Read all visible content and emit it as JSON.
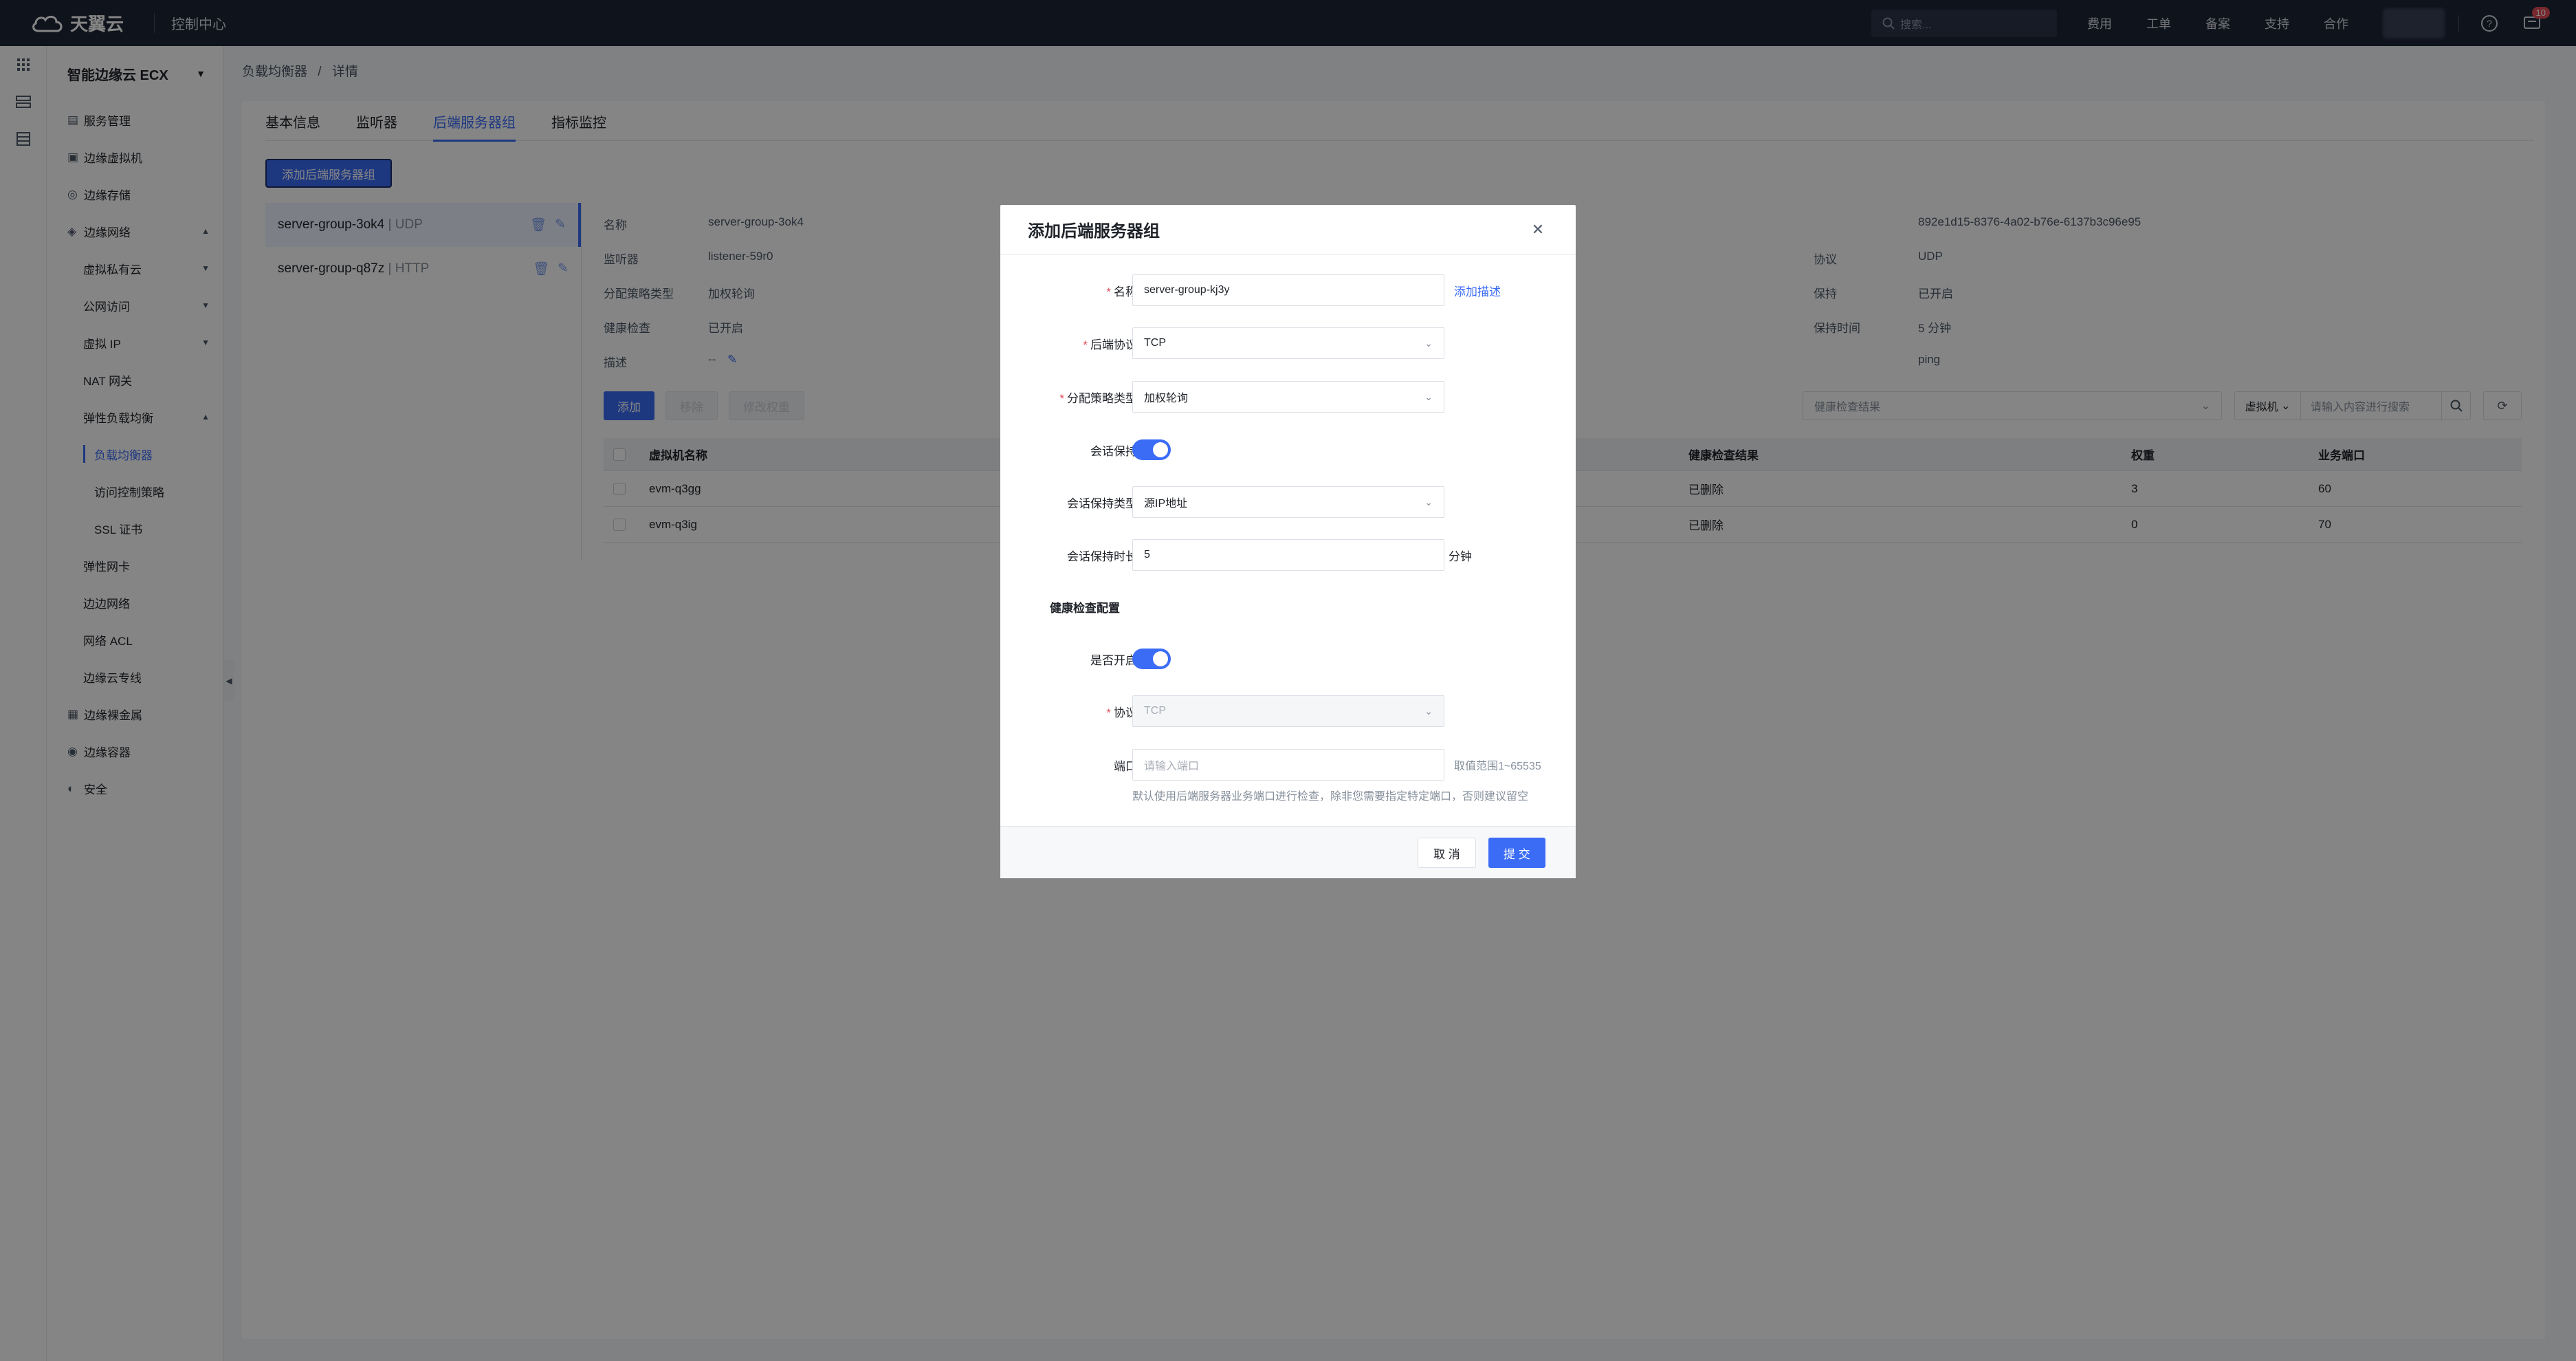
{
  "topbar": {
    "logo_text": "天翼云",
    "console_label": "控制中心",
    "search_placeholder": "搜索...",
    "links": [
      "费用",
      "工单",
      "备案",
      "支持",
      "合作"
    ],
    "notification_count": "10"
  },
  "sidebar": {
    "title": "智能边缘云 ECX",
    "items": [
      {
        "label": "服务管理",
        "level": 0,
        "icon": "list-icon"
      },
      {
        "label": "边缘虚拟机",
        "level": 0,
        "icon": "vm-icon"
      },
      {
        "label": "边缘存储",
        "level": 0,
        "icon": "storage-icon"
      },
      {
        "label": "边缘网络",
        "level": 0,
        "icon": "network-icon",
        "caret": "up"
      },
      {
        "label": "虚拟私有云",
        "level": 1,
        "caret": "down"
      },
      {
        "label": "公网访问",
        "level": 1,
        "caret": "down"
      },
      {
        "label": "虚拟 IP",
        "level": 1,
        "caret": "down"
      },
      {
        "label": "NAT 网关",
        "level": 1
      },
      {
        "label": "弹性负载均衡",
        "level": 1,
        "caret": "up"
      },
      {
        "label": "负载均衡器",
        "level": 2,
        "active": true
      },
      {
        "label": "访问控制策略",
        "level": 2
      },
      {
        "label": "SSL 证书",
        "level": 2
      },
      {
        "label": "弹性网卡",
        "level": 1
      },
      {
        "label": "边边网络",
        "level": 1
      },
      {
        "label": "网络 ACL",
        "level": 1
      },
      {
        "label": "边缘云专线",
        "level": 1
      },
      {
        "label": "边缘裸金属",
        "level": 0,
        "icon": "server-icon"
      },
      {
        "label": "边缘容器",
        "level": 0,
        "icon": "container-icon"
      },
      {
        "label": "安全",
        "level": 0,
        "icon": "shield-icon"
      }
    ]
  },
  "breadcrumb": {
    "parent": "负载均衡器",
    "separator": "/",
    "current": "详情"
  },
  "tabs": [
    {
      "label": "基本信息"
    },
    {
      "label": "监听器"
    },
    {
      "label": "后端服务器组",
      "active": true
    },
    {
      "label": "指标监控"
    }
  ],
  "add_group_button": "添加后端服务器组",
  "groups": [
    {
      "name": "server-group-3ok4",
      "protocol": "UDP"
    },
    {
      "name": "server-group-q87z",
      "protocol": "HTTP"
    }
  ],
  "group_separator": "|",
  "details_left": [
    {
      "key": "名称",
      "value": "server-group-3ok4"
    },
    {
      "key": "监听器",
      "value": "listener-59r0"
    },
    {
      "key": "分配策略类型",
      "value": "加权轮询"
    },
    {
      "key": "健康检查",
      "value": "已开启"
    },
    {
      "key": "描述",
      "value": "--"
    }
  ],
  "details_right": [
    {
      "key": "",
      "value": "892e1d15-8376-4a02-b76e-6137b3c96e95"
    },
    {
      "key": "协议",
      "value": "UDP"
    },
    {
      "key": "保持",
      "value": "已开启"
    },
    {
      "key": "保持时间",
      "value": "5 分钟"
    },
    {
      "key": "",
      "value": "ping"
    }
  ],
  "actions": {
    "add": "添加",
    "remove": "移除",
    "modify_weight": "修改权重"
  },
  "filters": {
    "health_select_placeholder": "健康检查结果",
    "search_type": "虚拟机",
    "search_placeholder": "请输入内容进行搜索"
  },
  "table": {
    "headers": {
      "name": "虚拟机名称",
      "health": "健康检查结果",
      "weight": "权重",
      "port": "业务端口"
    },
    "rows": [
      {
        "name": "evm-q3gg",
        "health": "已删除",
        "weight": "3",
        "port": "60"
      },
      {
        "name": "evm-q3ig",
        "health": "已删除",
        "weight": "0",
        "port": "70"
      }
    ]
  },
  "modal": {
    "title": "添加后端服务器组",
    "fields": {
      "name_label": "名称",
      "name_value": "server-group-kj3y",
      "add_desc_link": "添加描述",
      "protocol_label": "后端协议",
      "protocol_value": "TCP",
      "policy_label": "分配策略类型",
      "policy_value": "加权轮询",
      "session_label": "会话保持",
      "session_enabled": true,
      "session_type_label": "会话保持类型",
      "session_type_value": "源IP地址",
      "session_duration_label": "会话保持时长",
      "session_duration_value": "5",
      "session_duration_unit": "分钟",
      "health_section": "健康检查配置",
      "health_enabled_label": "是否开启",
      "health_enabled": true,
      "health_protocol_label": "协议",
      "health_protocol_value": "TCP",
      "port_label": "端口",
      "port_placeholder": "请输入端口",
      "port_range_hint": "取值范围1~65535",
      "port_help": "默认使用后端服务器业务端口进行检查，除非您需要指定特定端口，否则建议留空"
    },
    "cancel": "取 消",
    "submit": "提 交"
  }
}
